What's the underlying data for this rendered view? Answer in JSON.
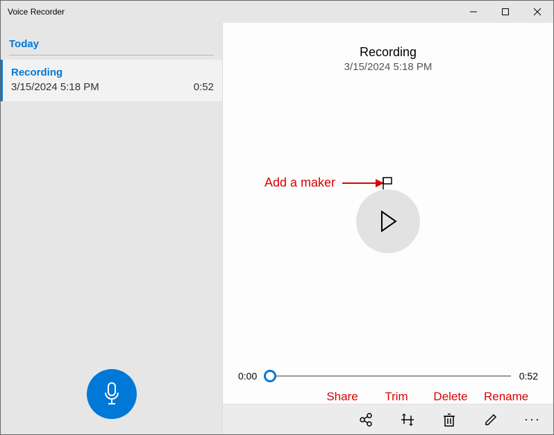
{
  "window": {
    "title": "Voice Recorder"
  },
  "sidebar": {
    "group_label": "Today",
    "items": [
      {
        "name": "Recording",
        "datetime": "3/15/2024 5:18 PM",
        "duration": "0:52"
      }
    ]
  },
  "detail": {
    "title": "Recording",
    "datetime": "3/15/2024 5:18 PM",
    "position": "0:00",
    "total": "0:52",
    "progress_pct": 2
  },
  "annotations": {
    "add_marker": "Add a maker",
    "share": "Share",
    "trim": "Trim",
    "delete": "Delete",
    "rename": "Rename"
  }
}
